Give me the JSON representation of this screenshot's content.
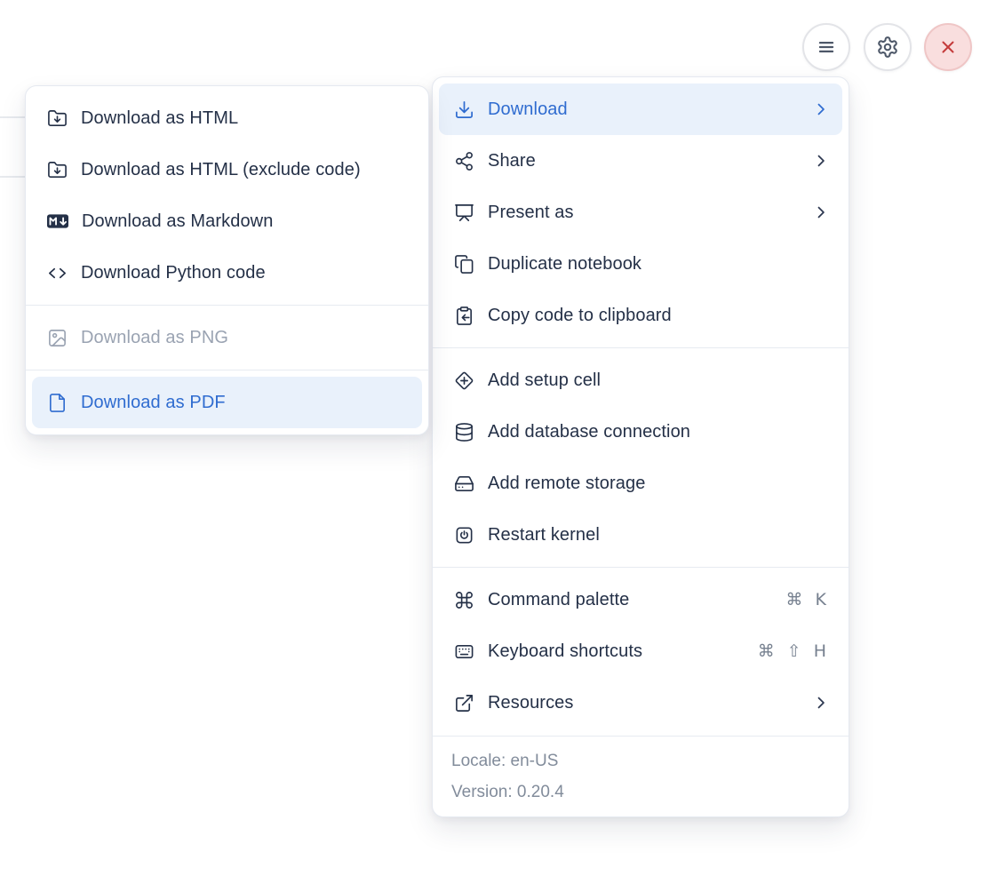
{
  "colors": {
    "accent_blue": "#2f6cd0",
    "highlight_bg": "#e9f1fb",
    "text_dark": "#243047",
    "disabled_gray": "#9aa3b2",
    "danger_red": "#c43c3c",
    "danger_bg": "#f9dede"
  },
  "header_buttons": {
    "menu": {
      "icon": "hamburger-menu-icon"
    },
    "settings": {
      "icon": "gear-icon"
    },
    "close": {
      "icon": "close-icon"
    }
  },
  "download_submenu": {
    "items": [
      {
        "label": "Download as HTML",
        "icon": "folder-down-icon",
        "state": "normal"
      },
      {
        "label": "Download as HTML (exclude code)",
        "icon": "folder-down-icon",
        "state": "normal"
      },
      {
        "label": "Download as Markdown",
        "icon": "markdown-icon",
        "state": "normal"
      },
      {
        "label": "Download Python code",
        "icon": "code-icon",
        "state": "normal"
      },
      {
        "label": "Download as PNG",
        "icon": "image-icon",
        "state": "disabled"
      },
      {
        "label": "Download as PDF",
        "icon": "file-icon",
        "state": "highlighted"
      }
    ]
  },
  "main_menu": {
    "items": [
      {
        "label": "Download",
        "icon": "download-icon",
        "has_submenu": true,
        "state": "highlighted"
      },
      {
        "label": "Share",
        "icon": "share-icon",
        "has_submenu": true
      },
      {
        "label": "Present as",
        "icon": "presentation-icon",
        "has_submenu": true
      },
      {
        "label": "Duplicate notebook",
        "icon": "duplicate-icon"
      },
      {
        "label": "Copy code to clipboard",
        "icon": "clipboard-copy-icon"
      },
      {
        "label": "Add setup cell",
        "icon": "diamond-plus-icon"
      },
      {
        "label": "Add database connection",
        "icon": "database-icon"
      },
      {
        "label": "Add remote storage",
        "icon": "hard-drive-icon"
      },
      {
        "label": "Restart kernel",
        "icon": "power-square-icon"
      },
      {
        "label": "Command palette",
        "icon": "command-icon",
        "shortcut": "⌘ K"
      },
      {
        "label": "Keyboard shortcuts",
        "icon": "keyboard-icon",
        "shortcut": "⌘ ⇧ H"
      },
      {
        "label": "Resources",
        "icon": "external-link-icon",
        "has_submenu": true
      }
    ],
    "footer": {
      "locale": "Locale: en-US",
      "version": "Version: 0.20.4"
    }
  }
}
